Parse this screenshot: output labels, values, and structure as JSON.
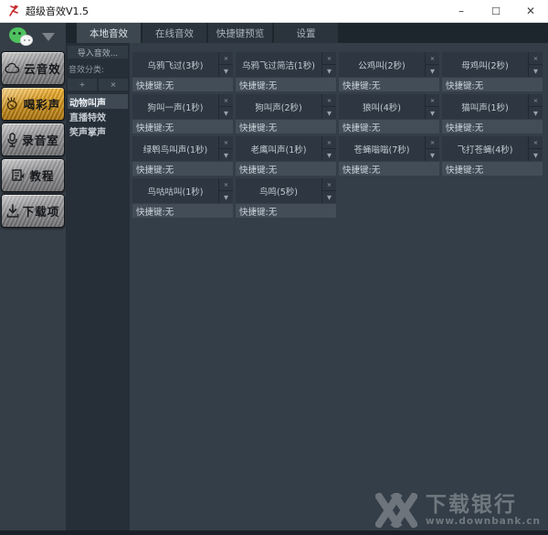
{
  "window": {
    "title": "超级音效V1.5",
    "controls": {
      "minimize": "–",
      "maximize": "☐",
      "close": "✕"
    }
  },
  "sidebar": {
    "items": [
      {
        "label": "云音效",
        "icon": "cloud-icon",
        "active": false
      },
      {
        "label": "喝彩声",
        "icon": "applause-icon",
        "active": true
      },
      {
        "label": "录音室",
        "icon": "microphone-icon",
        "active": false
      },
      {
        "label": "教程",
        "icon": "tutorial-icon",
        "active": false
      },
      {
        "label": "下载项",
        "icon": "download-icon",
        "active": false
      }
    ]
  },
  "tabs": [
    {
      "label": "本地音效",
      "active": true
    },
    {
      "label": "在线音效",
      "active": false
    },
    {
      "label": "快捷键预览",
      "active": false
    },
    {
      "label": "设置",
      "active": false
    }
  ],
  "category_panel": {
    "import_button": "导入音效...",
    "group_label": "音效分类:",
    "add_button": "+",
    "remove_button": "×",
    "categories": [
      {
        "label": "动物叫声",
        "active": true
      },
      {
        "label": "直播特效",
        "active": false
      },
      {
        "label": "笑声掌声",
        "active": false
      }
    ]
  },
  "sound_grid": {
    "close_glyph": "×",
    "dropdown_glyph": "▼",
    "tiles": [
      {
        "name": "乌鸦飞过(3秒)",
        "hotkey": "快捷键:无"
      },
      {
        "name": "乌鸦飞过简洁(1秒)",
        "hotkey": "快捷键:无"
      },
      {
        "name": "公鸡叫(2秒)",
        "hotkey": "快捷键:无"
      },
      {
        "name": "母鸡叫(2秒)",
        "hotkey": "快捷键:无"
      },
      {
        "name": "狗叫一声(1秒)",
        "hotkey": "快捷键:无"
      },
      {
        "name": "狗叫声(2秒)",
        "hotkey": "快捷键:无"
      },
      {
        "name": "狼叫(4秒)",
        "hotkey": "快捷键:无"
      },
      {
        "name": "猫叫声(1秒)",
        "hotkey": "快捷键:无"
      },
      {
        "name": "绿鹎鸟叫声(1秒)",
        "hotkey": "快捷键:无"
      },
      {
        "name": "老鹰叫声(1秒)",
        "hotkey": "快捷键:无"
      },
      {
        "name": "苍蝇嗡嗡(7秒)",
        "hotkey": "快捷键:无"
      },
      {
        "name": "飞打苍蝇(4秒)",
        "hotkey": "快捷键:无"
      },
      {
        "name": "鸟咕咕叫(1秒)",
        "hotkey": "快捷键:无"
      },
      {
        "name": "鸟鸣(5秒)",
        "hotkey": "快捷键:无"
      }
    ]
  },
  "watermark": {
    "title": "下载银行",
    "url": "www.downbank.cn"
  },
  "colors": {
    "accent_gold": "#e8a31c",
    "panel_bg": "#262f37",
    "main_bg": "#343e48",
    "tile_bg": "#2e3741",
    "hotkey_bg": "#424d58",
    "wechat_green": "#4fc25f"
  }
}
